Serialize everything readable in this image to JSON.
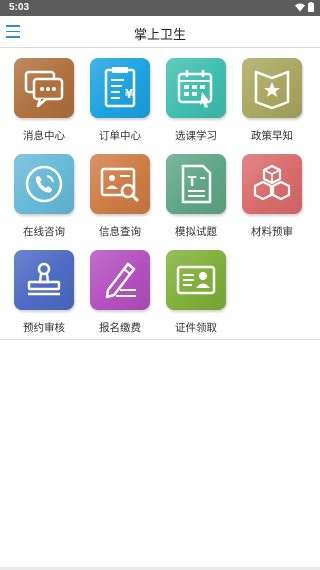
{
  "status_bar": {
    "time": "5:03"
  },
  "header": {
    "title": "掌上卫生"
  },
  "tiles": [
    {
      "label": "消息中心",
      "icon": "chat-bubbles-icon",
      "color": "#b0713e"
    },
    {
      "label": "订单中心",
      "icon": "receipt-icon",
      "color": "#1ca3e0"
    },
    {
      "label": "选课学习",
      "icon": "calendar-icon",
      "color": "#3fbfb0"
    },
    {
      "label": "政策早知",
      "icon": "star-book-icon",
      "color": "#a8a861"
    },
    {
      "label": "在线咨询",
      "icon": "phone-icon",
      "color": "#67b9d8"
    },
    {
      "label": "信息查询",
      "icon": "search-card-icon",
      "color": "#cf7c45"
    },
    {
      "label": "模拟试题",
      "icon": "test-paper-icon",
      "color": "#5fa688"
    },
    {
      "label": "材料预审",
      "icon": "boxes-icon",
      "color": "#d96c6c"
    },
    {
      "label": "预约审核",
      "icon": "stamp-icon",
      "color": "#4d6bc4"
    },
    {
      "label": "报名缴费",
      "icon": "pen-icon",
      "color": "#b351bf"
    },
    {
      "label": "证件领取",
      "icon": "id-card-icon",
      "color": "#80b03a"
    }
  ]
}
